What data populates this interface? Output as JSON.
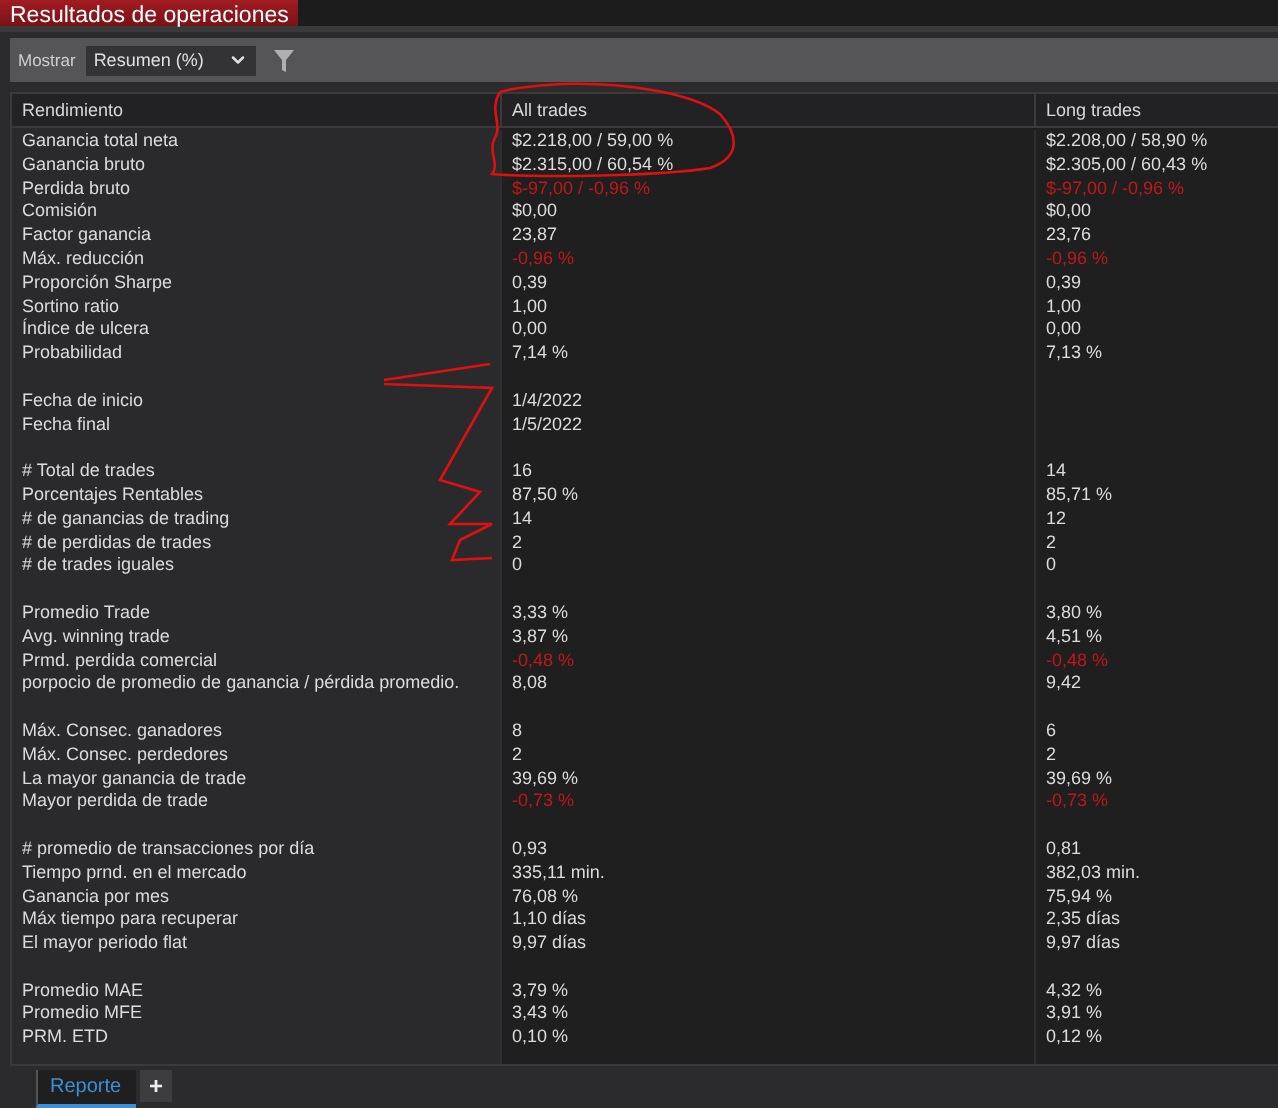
{
  "title": "Resultados de operaciones",
  "toolbar": {
    "label": "Mostrar",
    "select": "Resumen (%)"
  },
  "table": {
    "columns": [
      "Rendimiento",
      "All trades",
      "Long trades"
    ],
    "sections": [
      {
        "rows": [
          {
            "label": "Ganancia total neta",
            "values": [
              {
                "text": "$2.218,00 / 59,00 %",
                "negative": false
              },
              {
                "text": "$2.208,00 / 58,90 %",
                "negative": false
              }
            ]
          },
          {
            "label": "Ganancia bruto",
            "values": [
              {
                "text": "$2.315,00 / 60,54 %",
                "negative": false
              },
              {
                "text": "$2.305,00 / 60,43 %",
                "negative": false
              }
            ]
          },
          {
            "label": "Perdida bruto",
            "values": [
              {
                "text": "$-97,00 / -0,96 %",
                "negative": true
              },
              {
                "text": "$-97,00 / -0,96 %",
                "negative": true
              }
            ]
          },
          {
            "label": "Comisión",
            "values": [
              {
                "text": "$0,00",
                "negative": false
              },
              {
                "text": "$0,00",
                "negative": false
              }
            ]
          },
          {
            "label": "Factor ganancia",
            "values": [
              {
                "text": "23,87",
                "negative": false
              },
              {
                "text": "23,76",
                "negative": false
              }
            ]
          },
          {
            "label": "Máx. reducción",
            "values": [
              {
                "text": "-0,96 %",
                "negative": true
              },
              {
                "text": "-0,96 %",
                "negative": true
              }
            ]
          },
          {
            "label": "Proporción Sharpe",
            "values": [
              {
                "text": "0,39",
                "negative": false
              },
              {
                "text": "0,39",
                "negative": false
              }
            ]
          },
          {
            "label": "Sortino ratio",
            "values": [
              {
                "text": "1,00",
                "negative": false
              },
              {
                "text": "1,00",
                "negative": false
              }
            ]
          },
          {
            "label": "Índice de ulcera",
            "values": [
              {
                "text": "0,00",
                "negative": false
              },
              {
                "text": "0,00",
                "negative": false
              }
            ]
          },
          {
            "label": "Probabilidad",
            "values": [
              {
                "text": "7,14 %",
                "negative": false
              },
              {
                "text": "7,13 %",
                "negative": false
              }
            ]
          }
        ]
      },
      {
        "rows": [
          {
            "label": "Fecha de inicio",
            "values": [
              {
                "text": "1/4/2022",
                "negative": false
              }
            ]
          },
          {
            "label": "Fecha final",
            "values": [
              {
                "text": "1/5/2022",
                "negative": false
              }
            ]
          }
        ]
      },
      {
        "rows": [
          {
            "label": "# Total de trades",
            "values": [
              {
                "text": "16",
                "negative": false
              },
              {
                "text": "14",
                "negative": false
              }
            ]
          },
          {
            "label": "Porcentajes Rentables",
            "values": [
              {
                "text": "87,50 %",
                "negative": false
              },
              {
                "text": "85,71 %",
                "negative": false
              }
            ]
          },
          {
            "label": "# de ganancias de trading",
            "values": [
              {
                "text": "14",
                "negative": false
              },
              {
                "text": "12",
                "negative": false
              }
            ]
          },
          {
            "label": "# de perdidas de trades",
            "values": [
              {
                "text": "2",
                "negative": false
              },
              {
                "text": "2",
                "negative": false
              }
            ]
          },
          {
            "label": "# de trades iguales",
            "values": [
              {
                "text": "0",
                "negative": false
              },
              {
                "text": "0",
                "negative": false
              }
            ]
          }
        ]
      },
      {
        "rows": [
          {
            "label": "Promedio Trade",
            "values": [
              {
                "text": "3,33 %",
                "negative": false
              },
              {
                "text": "3,80 %",
                "negative": false
              }
            ]
          },
          {
            "label": "Avg. winning trade",
            "values": [
              {
                "text": "3,87 %",
                "negative": false
              },
              {
                "text": "4,51 %",
                "negative": false
              }
            ]
          },
          {
            "label": "Prmd. perdida comercial",
            "values": [
              {
                "text": "-0,48 %",
                "negative": true
              },
              {
                "text": "-0,48 %",
                "negative": true
              }
            ]
          },
          {
            "label": "porpocio de promedio de ganancia / pérdida promedio.",
            "values": [
              {
                "text": "8,08",
                "negative": false
              },
              {
                "text": "9,42",
                "negative": false
              }
            ]
          }
        ]
      },
      {
        "rows": [
          {
            "label": "Máx. Consec. ganadores",
            "values": [
              {
                "text": "8",
                "negative": false
              },
              {
                "text": "6",
                "negative": false
              }
            ]
          },
          {
            "label": "Máx. Consec. perdedores",
            "values": [
              {
                "text": "2",
                "negative": false
              },
              {
                "text": "2",
                "negative": false
              }
            ]
          },
          {
            "label": "La mayor ganancia de trade",
            "values": [
              {
                "text": "39,69 %",
                "negative": false
              },
              {
                "text": "39,69 %",
                "negative": false
              }
            ]
          },
          {
            "label": "Mayor perdida de trade",
            "values": [
              {
                "text": "-0,73 %",
                "negative": true
              },
              {
                "text": "-0,73 %",
                "negative": true
              }
            ]
          }
        ]
      },
      {
        "rows": [
          {
            "label": "# promedio de transacciones por día",
            "values": [
              {
                "text": "0,93",
                "negative": false
              },
              {
                "text": "0,81",
                "negative": false
              }
            ]
          },
          {
            "label": "Tiempo prnd. en el mercado",
            "values": [
              {
                "text": "335,11 min.",
                "negative": false
              },
              {
                "text": "382,03 min.",
                "negative": false
              }
            ]
          },
          {
            "label": "Ganancia por mes",
            "values": [
              {
                "text": "76,08 %",
                "negative": false
              },
              {
                "text": "75,94 %",
                "negative": false
              }
            ]
          },
          {
            "label": "Máx tiempo para recuperar",
            "values": [
              {
                "text": "1,10 días",
                "negative": false
              },
              {
                "text": "2,35 días",
                "negative": false
              }
            ]
          },
          {
            "label": "El mayor periodo flat",
            "values": [
              {
                "text": "9,97 días",
                "negative": false
              },
              {
                "text": "9,97 días",
                "negative": false
              }
            ]
          }
        ]
      },
      {
        "rows": [
          {
            "label": "Promedio MAE",
            "values": [
              {
                "text": "3,79 %",
                "negative": false
              },
              {
                "text": "4,32 %",
                "negative": false
              }
            ]
          },
          {
            "label": "Promedio MFE",
            "values": [
              {
                "text": "3,43 %",
                "negative": false
              },
              {
                "text": "3,91 %",
                "negative": false
              }
            ]
          },
          {
            "label": "PRM. ETD",
            "values": [
              {
                "text": "0,10 %",
                "negative": false
              },
              {
                "text": "0,12 %",
                "negative": false
              }
            ]
          }
        ]
      }
    ]
  },
  "tabs": [
    {
      "label": "Reporte",
      "selected": true
    }
  ],
  "add_tab": "+"
}
